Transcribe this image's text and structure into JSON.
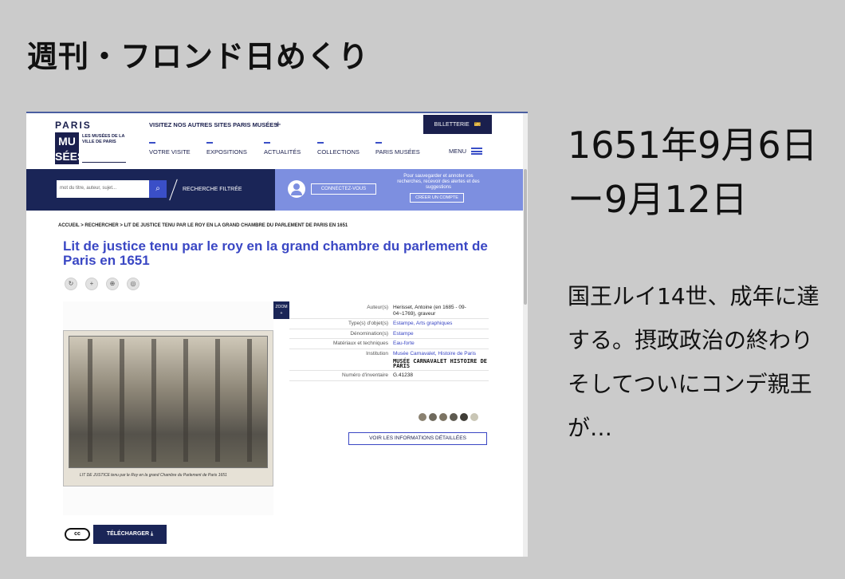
{
  "heading": "週刊・フロンド日めくり",
  "date_range": "1651年9月6日ー9月12日",
  "description": "国王ルイ14世、成年に達する。摂政政治の終わり　そしてついにコンデ親王が…",
  "site": {
    "logo": {
      "paris": "PARIS",
      "mu": "MU",
      "ses": "SÉES",
      "sub": "LES MUSÉES DE LA VILLE DE PARIS"
    },
    "top_link": "VISITEZ NOS AUTRES SITES PARIS MUSÉES",
    "billetterie": "BILLETTERIE",
    "nav": [
      "VOTRE VISITE",
      "EXPOSITIONS",
      "ACTUALITÉS",
      "COLLECTIONS",
      "PARIS MUSÉES"
    ],
    "menu": "MENU",
    "search_placeholder": "mot du titre, auteur, sujet...",
    "recherche_filtree": "RECHERCHE FILTRÉE",
    "connect": "CONNECTEZ-VOUS",
    "save_text": "Pour sauvegarder et annoter vos recherches, recevoir des alertes et des suggestions",
    "create_account": "CRÉER UN COMPTE",
    "breadcrumb": "ACCUEIL > RECHERCHER > LIT DE JUSTICE TENU PAR LE ROY EN LA GRAND CHAMBRE DU PARLEMENT DE PARIS EN 1651",
    "title": "Lit de justice tenu par le roy en la grand chambre du parlement de Paris en 1651",
    "zoom": "ZOOM",
    "caption": "LIT DE JUSTICE tenu par le Roy en la grand Chambre du Parlement de Paris 1651",
    "metadata": [
      {
        "k": "Auteur(s)",
        "v": "Herisset, Antoine (en 1685 - 09-04~1769), graveur"
      },
      {
        "k": "Type(s) d'objet(s)",
        "v": "Estampe, Arts graphiques"
      },
      {
        "k": "Dénomination(s)",
        "v": "Estampe"
      },
      {
        "k": "Matériaux et techniques",
        "v": "Eau-forte"
      },
      {
        "k": "Institution",
        "v": "Musée Carnavalet, Histoire de Paris"
      },
      {
        "k": "Numéro d'inventaire",
        "v": "G.41238"
      }
    ],
    "carnavalet_logo": "MUSÉE CARNAVALET HISTOIRE DE PARIS",
    "swatches": [
      "#8a8170",
      "#6f6a5d",
      "#7c7463",
      "#5e5a50",
      "#3f3d37",
      "#c9c6b5"
    ],
    "details_button": "VOIR LES INFORMATIONS DÉTAILLÉES",
    "cc": "cc",
    "download": "TÉLÉCHARGER"
  }
}
